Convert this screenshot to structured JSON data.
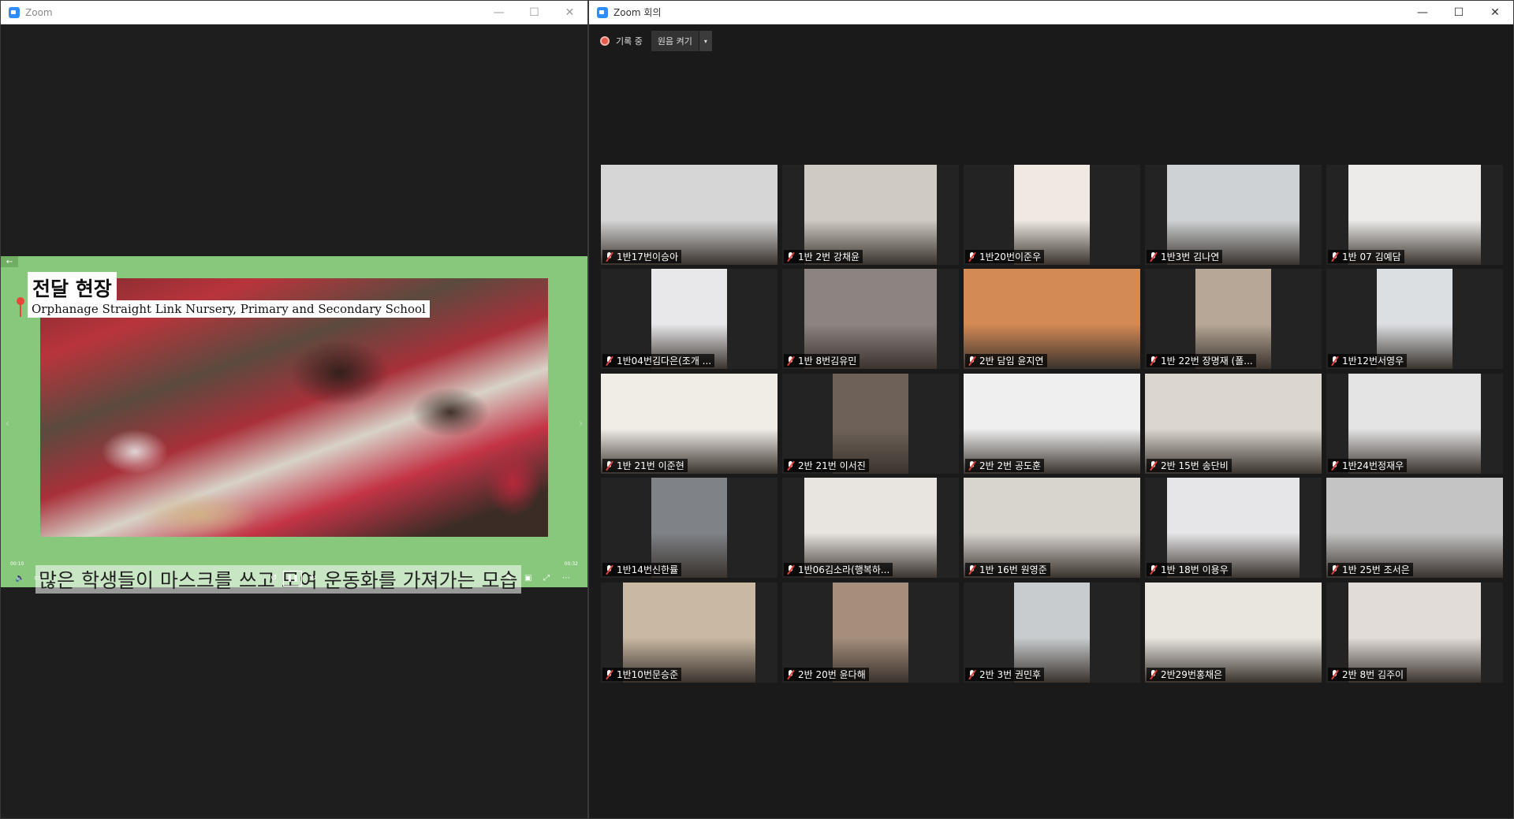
{
  "left_window": {
    "title": "Zoom",
    "controls": [
      "—",
      "☐",
      "✕"
    ],
    "share": {
      "back_icon": "left-arrow-icon",
      "slide_title": "전달 현장",
      "slide_subtitle": "Orphanage Straight Link Nursery, Primary and Secondary School",
      "caption": "많은 학생들이 마스크를 쓰고 모여 운동화를 가져가는 모습",
      "time_elapsed": "00:10",
      "time_total": "00:32",
      "colors": {
        "frame": "#88c87c"
      }
    }
  },
  "right_window": {
    "title": "Zoom 회의",
    "controls": [
      "—",
      "☐",
      "✕"
    ],
    "recording": {
      "status": "기록 중",
      "button": "원음 켜기",
      "dropdown": "▾"
    },
    "participants": [
      [
        "1반17번이승아",
        "1반 2번 강채윤",
        "1반20번이준우",
        "1반3번 김나연",
        "1반 07 김예담"
      ],
      [
        "1반04번김다은(조개 ...",
        "1반 8번김유민",
        "2반 담임 윤지연",
        "1반 22번 장명재 (폴...",
        "1반12번서영우"
      ],
      [
        "1반 21번 이준현",
        "2반 21번 이서진",
        "2반 2번 공도훈",
        "2반 15번 송단비",
        "1반24번정재우"
      ],
      [
        "1반14번신한률",
        "1반06김소라(행복하...",
        "1반 16번 원영준",
        "1반 18번 이용우",
        "1반 25번 조서은"
      ],
      [
        "1반10번문승준",
        "2반 20번 윤다해",
        "2반 3번 권민후",
        "2반29번홍채은",
        "2반 8번 김주이"
      ]
    ],
    "colors": {
      "muted_mic": "#e0403a",
      "rec_dot": "#e35a4e"
    }
  }
}
